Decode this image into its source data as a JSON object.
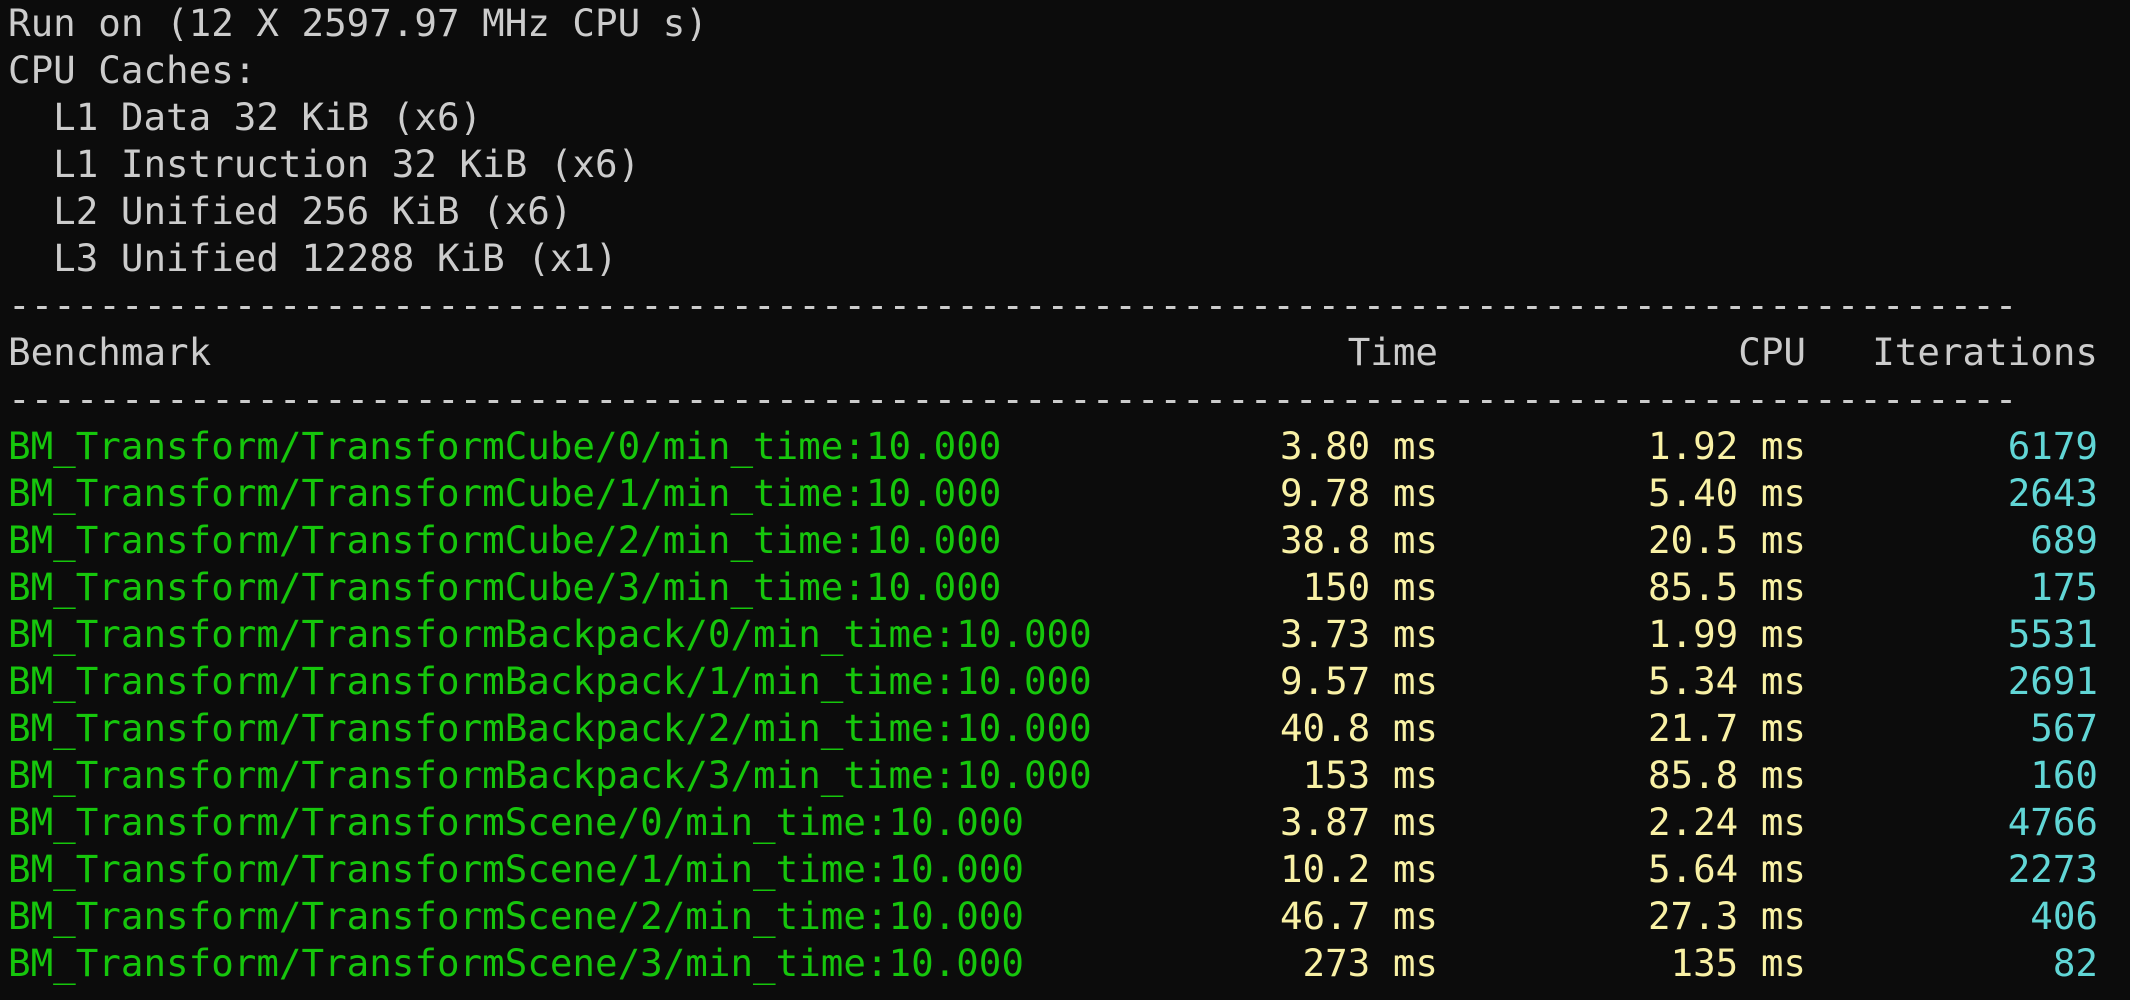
{
  "header": {
    "run_line": "Run on (12 X 2597.97 MHz CPU s)",
    "caches_title": "CPU Caches:",
    "caches": [
      "  L1 Data 32 KiB (x6)",
      "  L1 Instruction 32 KiB (x6)",
      "  L2 Unified 256 KiB (x6)",
      "  L3 Unified 12288 KiB (x1)"
    ]
  },
  "separator": "-----------------------------------------------------------------------------------------",
  "table": {
    "columns": {
      "benchmark": "Benchmark",
      "time": "Time",
      "cpu": "CPU",
      "iterations": "Iterations"
    },
    "rows": [
      {
        "name": "BM_Transform/TransformCube/0/min_time:10.000",
        "time": "3.80 ms",
        "cpu": "1.92 ms",
        "iterations": "6179"
      },
      {
        "name": "BM_Transform/TransformCube/1/min_time:10.000",
        "time": "9.78 ms",
        "cpu": "5.40 ms",
        "iterations": "2643"
      },
      {
        "name": "BM_Transform/TransformCube/2/min_time:10.000",
        "time": "38.8 ms",
        "cpu": "20.5 ms",
        "iterations": "689"
      },
      {
        "name": "BM_Transform/TransformCube/3/min_time:10.000",
        "time": "150 ms",
        "cpu": "85.5 ms",
        "iterations": "175"
      },
      {
        "name": "BM_Transform/TransformBackpack/0/min_time:10.000",
        "time": "3.73 ms",
        "cpu": "1.99 ms",
        "iterations": "5531"
      },
      {
        "name": "BM_Transform/TransformBackpack/1/min_time:10.000",
        "time": "9.57 ms",
        "cpu": "5.34 ms",
        "iterations": "2691"
      },
      {
        "name": "BM_Transform/TransformBackpack/2/min_time:10.000",
        "time": "40.8 ms",
        "cpu": "21.7 ms",
        "iterations": "567"
      },
      {
        "name": "BM_Transform/TransformBackpack/3/min_time:10.000",
        "time": "153 ms",
        "cpu": "85.8 ms",
        "iterations": "160"
      },
      {
        "name": "BM_Transform/TransformScene/0/min_time:10.000",
        "time": "3.87 ms",
        "cpu": "2.24 ms",
        "iterations": "4766"
      },
      {
        "name": "BM_Transform/TransformScene/1/min_time:10.000",
        "time": "10.2 ms",
        "cpu": "5.64 ms",
        "iterations": "2273"
      },
      {
        "name": "BM_Transform/TransformScene/2/min_time:10.000",
        "time": "46.7 ms",
        "cpu": "27.3 ms",
        "iterations": "406"
      },
      {
        "name": "BM_Transform/TransformScene/3/min_time:10.000",
        "time": "273 ms",
        "cpu": "135 ms",
        "iterations": "82"
      }
    ]
  },
  "colors": {
    "background": "#0c0c0c",
    "default_text": "#cccccc",
    "benchmark_name": "#16c60c",
    "time_values": "#f9f1a5",
    "iteration_values": "#61d6d6"
  }
}
